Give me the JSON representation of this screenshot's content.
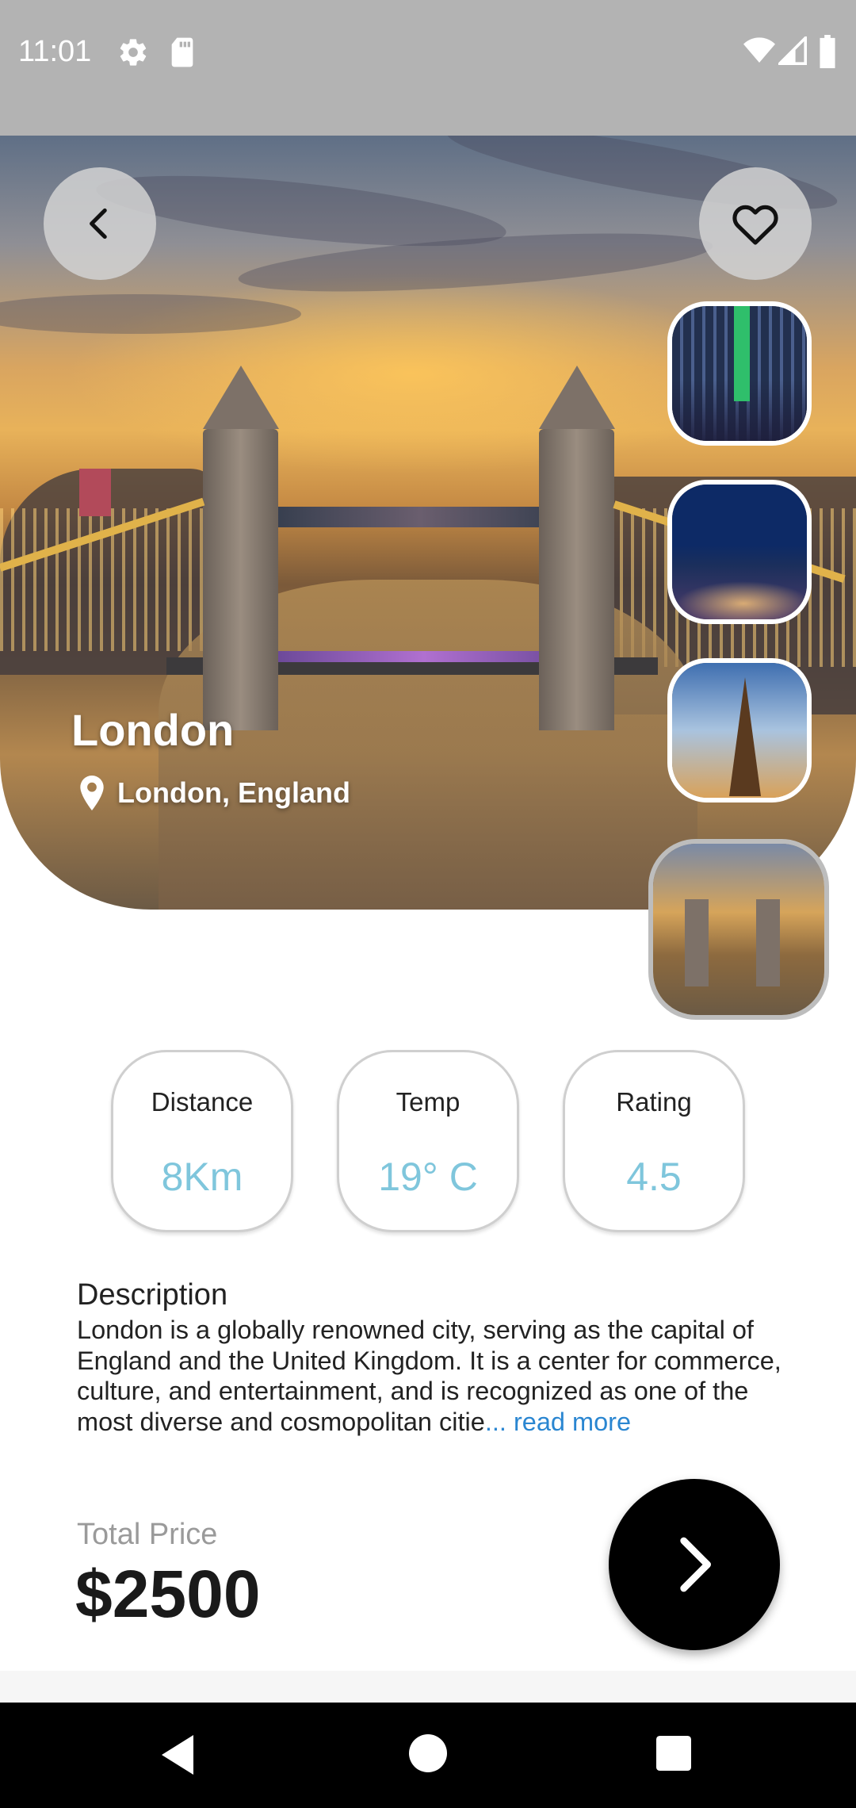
{
  "status_bar": {
    "time": "11:01",
    "icons": [
      "settings-icon",
      "sd-card-icon",
      "wifi-icon",
      "signal-icon",
      "battery-icon"
    ]
  },
  "hero": {
    "title": "London",
    "location": "London, England",
    "icons": [
      "back-icon",
      "heart-icon",
      "location-pin-icon"
    ]
  },
  "gallery": {
    "thumbnails": [
      {
        "name": "New York skyline",
        "selected": false
      },
      {
        "name": "City at night",
        "selected": false
      },
      {
        "name": "Eiffel Tower",
        "selected": false
      },
      {
        "name": "Tower Bridge",
        "selected": true
      }
    ]
  },
  "stats": [
    {
      "label": "Distance",
      "value": "8Km"
    },
    {
      "label": "Temp",
      "value": "19° C"
    },
    {
      "label": "Rating",
      "value": "4.5"
    }
  ],
  "description": {
    "title": "Description",
    "text": "London is a globally renowned city, serving as the capital of England and the United Kingdom. It is a center for commerce, culture, and entertainment, and is recognized as one of the most diverse and cosmopolitan citie",
    "read_more": "... read more"
  },
  "price": {
    "label": "Total Price",
    "value": "$2500"
  },
  "colors": {
    "accent": "#7fc6dc",
    "link": "#2a86d1",
    "status_bar": "#b3b3b3"
  },
  "nav_bar": {
    "icons": [
      "nav-back-icon",
      "nav-home-icon",
      "nav-recents-icon"
    ]
  }
}
